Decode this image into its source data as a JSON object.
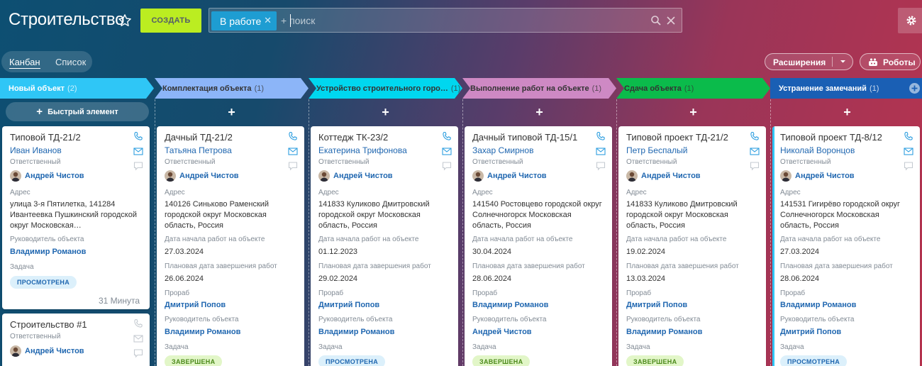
{
  "header": {
    "title": "Строительство",
    "create_label": "СОЗДАТЬ",
    "filter_chip": "В работе",
    "search_placeholder": "+ поиск"
  },
  "views": {
    "kanban": "Канбан",
    "list": "Список"
  },
  "actions": {
    "extensions": "Расширения",
    "robots": "Роботы"
  },
  "quick_add_label": "Быстрый элемент",
  "labels": {
    "responsible": "Ответственный",
    "address": "Адрес",
    "object_head": "Руководитель объекта",
    "task": "Задача",
    "start_date": "Дата начала работ на объекте",
    "planned_end": "Плановая дата завершения работ",
    "foreman": "Прораб"
  },
  "columns": [
    {
      "name": "Новый объект",
      "count": "(2)",
      "color": "#2fc6f6",
      "text_color": "#ffffff",
      "cards": [
        {
          "title": "Типовой ТД-21/2",
          "client": "Иван Иванов",
          "responsible": "Андрей Чистов",
          "address": "улица 3-я Пятилетка, 141284 Ивантеевка Пушкинский городской округ Московская…",
          "object_head": "Владимир Романов",
          "status": "ПРОСМОТРЕНА",
          "time": "31 Минута"
        },
        {
          "title": "Строительство #1",
          "responsible": "Андрей Чистов"
        }
      ]
    },
    {
      "name": "Комплектация объекта",
      "count": "(1)",
      "color": "#8cb5f8",
      "text_color": "#333333",
      "cards": [
        {
          "title": "Дачный ТД-21/2",
          "client": "Татьяна Петрова",
          "responsible": "Андрей Чистов",
          "address": "140126 Синьково Раменский городской округ Московская область, Россия",
          "start_date": "27.03.2024",
          "planned_end": "26.06.2024",
          "foreman": "Дмитрий Попов",
          "object_head": "Владимир Романов",
          "status": "ЗАВЕРШЕНА"
        }
      ]
    },
    {
      "name": "Устройство строительного горо…",
      "count": "(1)",
      "color": "#00d7ef",
      "text_color": "#333333",
      "cards": [
        {
          "title": "Коттедж ТК-23/2",
          "client": "Екатерина Трифонова",
          "responsible": "Андрей Чистов",
          "address": "141833 Куликово Дмитровский городской округ Московская область, Россия",
          "start_date": "01.12.2023",
          "planned_end": "29.02.2024",
          "foreman": "Дмитрий Попов",
          "object_head": "Владимир Романов",
          "status": "ПРОСМОТРЕНА"
        }
      ]
    },
    {
      "name": "Выполнение работ на объекте",
      "count": "(1)",
      "color": "#ce89c4",
      "text_color": "#333333",
      "cards": [
        {
          "title": "Дачный типовой ТД-15/1",
          "client": "Захар Смирнов",
          "responsible": "Андрей Чистов",
          "address": "141540 Ростовцево городской округ Солнечногорск Московская область, Россия",
          "start_date": "30.04.2024",
          "planned_end": "28.06.2024",
          "foreman": "Владимир Романов",
          "object_head": "Андрей Чистов",
          "status": "ЗАВЕРШЕНА"
        }
      ]
    },
    {
      "name": "Сдача объекта",
      "count": "(1)",
      "color": "#0bbb4b",
      "text_color": "#333333",
      "cards": [
        {
          "title": "Типовой проект ТД-21/2",
          "client": "Петр Беспалый",
          "responsible": "Андрей Чистов",
          "address": "141833 Куликово Дмитровский городской округ Московская область, Россия",
          "start_date": "19.02.2024",
          "planned_end": "13.03.2024",
          "foreman": "Дмитрий Попов",
          "object_head": "Владимир Романов",
          "status": "ЗАВЕРШЕНА"
        }
      ]
    },
    {
      "name": "Устранение замечаний",
      "count": "(1)",
      "color": "#1a5fb4",
      "text_color": "#ffffff",
      "cards": [
        {
          "title": "Типовой проект ТД-8/12",
          "client": "Николай Воронцов",
          "responsible": "Андрей Чистов",
          "address": "141531 Гигирёво городской округ Солнечногорск Московская область, Россия",
          "start_date": "27.03.2024",
          "planned_end": "28.06.2024",
          "foreman": "Владимир Романов",
          "object_head": "Дмитрий Попов",
          "status": "ПРОСМОТРЕНА"
        }
      ]
    }
  ]
}
